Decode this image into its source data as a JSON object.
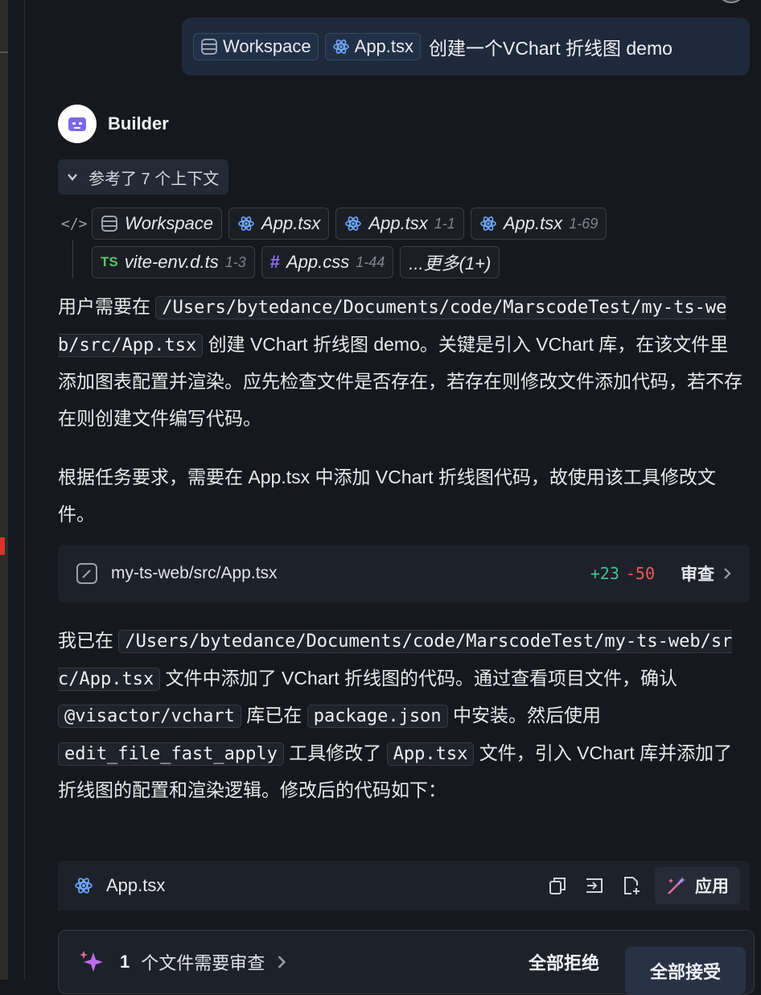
{
  "user_message": {
    "chips": [
      {
        "icon": "database-icon",
        "label": "Workspace"
      },
      {
        "icon": "react-icon",
        "label": "App.tsx"
      }
    ],
    "text": "创建一个VChart 折线图 demo"
  },
  "builder": {
    "name": "Builder",
    "context_toggle": "参考了 7 个上下文",
    "context_rows": [
      [
        {
          "icon": "database-icon",
          "label": "Workspace",
          "range": ""
        },
        {
          "icon": "react-icon",
          "label": "App.tsx",
          "range": ""
        },
        {
          "icon": "react-icon",
          "label": "App.tsx",
          "range": "1-1"
        },
        {
          "icon": "react-icon",
          "label": "App.tsx",
          "range": "1-69"
        }
      ],
      [
        {
          "icon": "ts-icon",
          "label": "vite-env.d.ts",
          "range": "1-3"
        },
        {
          "icon": "hash-icon",
          "label": "App.css",
          "range": "1-44"
        },
        {
          "icon": "",
          "label": "...更多(1+)",
          "range": ""
        }
      ]
    ]
  },
  "para1": {
    "prefix": "用户需要在 ",
    "code": "/Users/bytedance/Documents/code/MarscodeTest/my-ts-web/src/App.tsx",
    "suffix": " 创建 VChart 折线图 demo。关键是引入 VChart 库，在该文件里添加图表配置并渲染。应先检查文件是否存在，若存在则修改文件添加代码，若不存在则创建文件编写代码。"
  },
  "para2": "根据任务要求，需要在 App.tsx 中添加 VChart 折线图代码，故使用该工具修改文件。",
  "file_card": {
    "path": "my-ts-web/src/App.tsx",
    "added": "+23",
    "removed": "-50",
    "review_label": "审查"
  },
  "para3": {
    "t1": "我已在 ",
    "c1": "/Users/bytedance/Documents/code/MarscodeTest/my-ts-web/src/App.tsx",
    "t2": " 文件中添加了 VChart 折线图的代码。通过查看项目文件，确认 ",
    "c2": "@visactor/vchart",
    "t3": " 库已在 ",
    "c3": "package.json",
    "t4": " 中安装。然后使用 ",
    "c4": "edit_file_fast_apply",
    "t5": " 工具修改了 ",
    "c5": "App.tsx",
    "t6": " 文件，引入 VChart 库并添加了折线图的配置和渲染逻辑。修改后的代码如下："
  },
  "code_block": {
    "filename": "App.tsx",
    "apply_label": "应用"
  },
  "review_bar": {
    "count": "1",
    "label": "个文件需要审查",
    "reject_all": "全部拒绝",
    "accept_all": "全部接受"
  }
}
